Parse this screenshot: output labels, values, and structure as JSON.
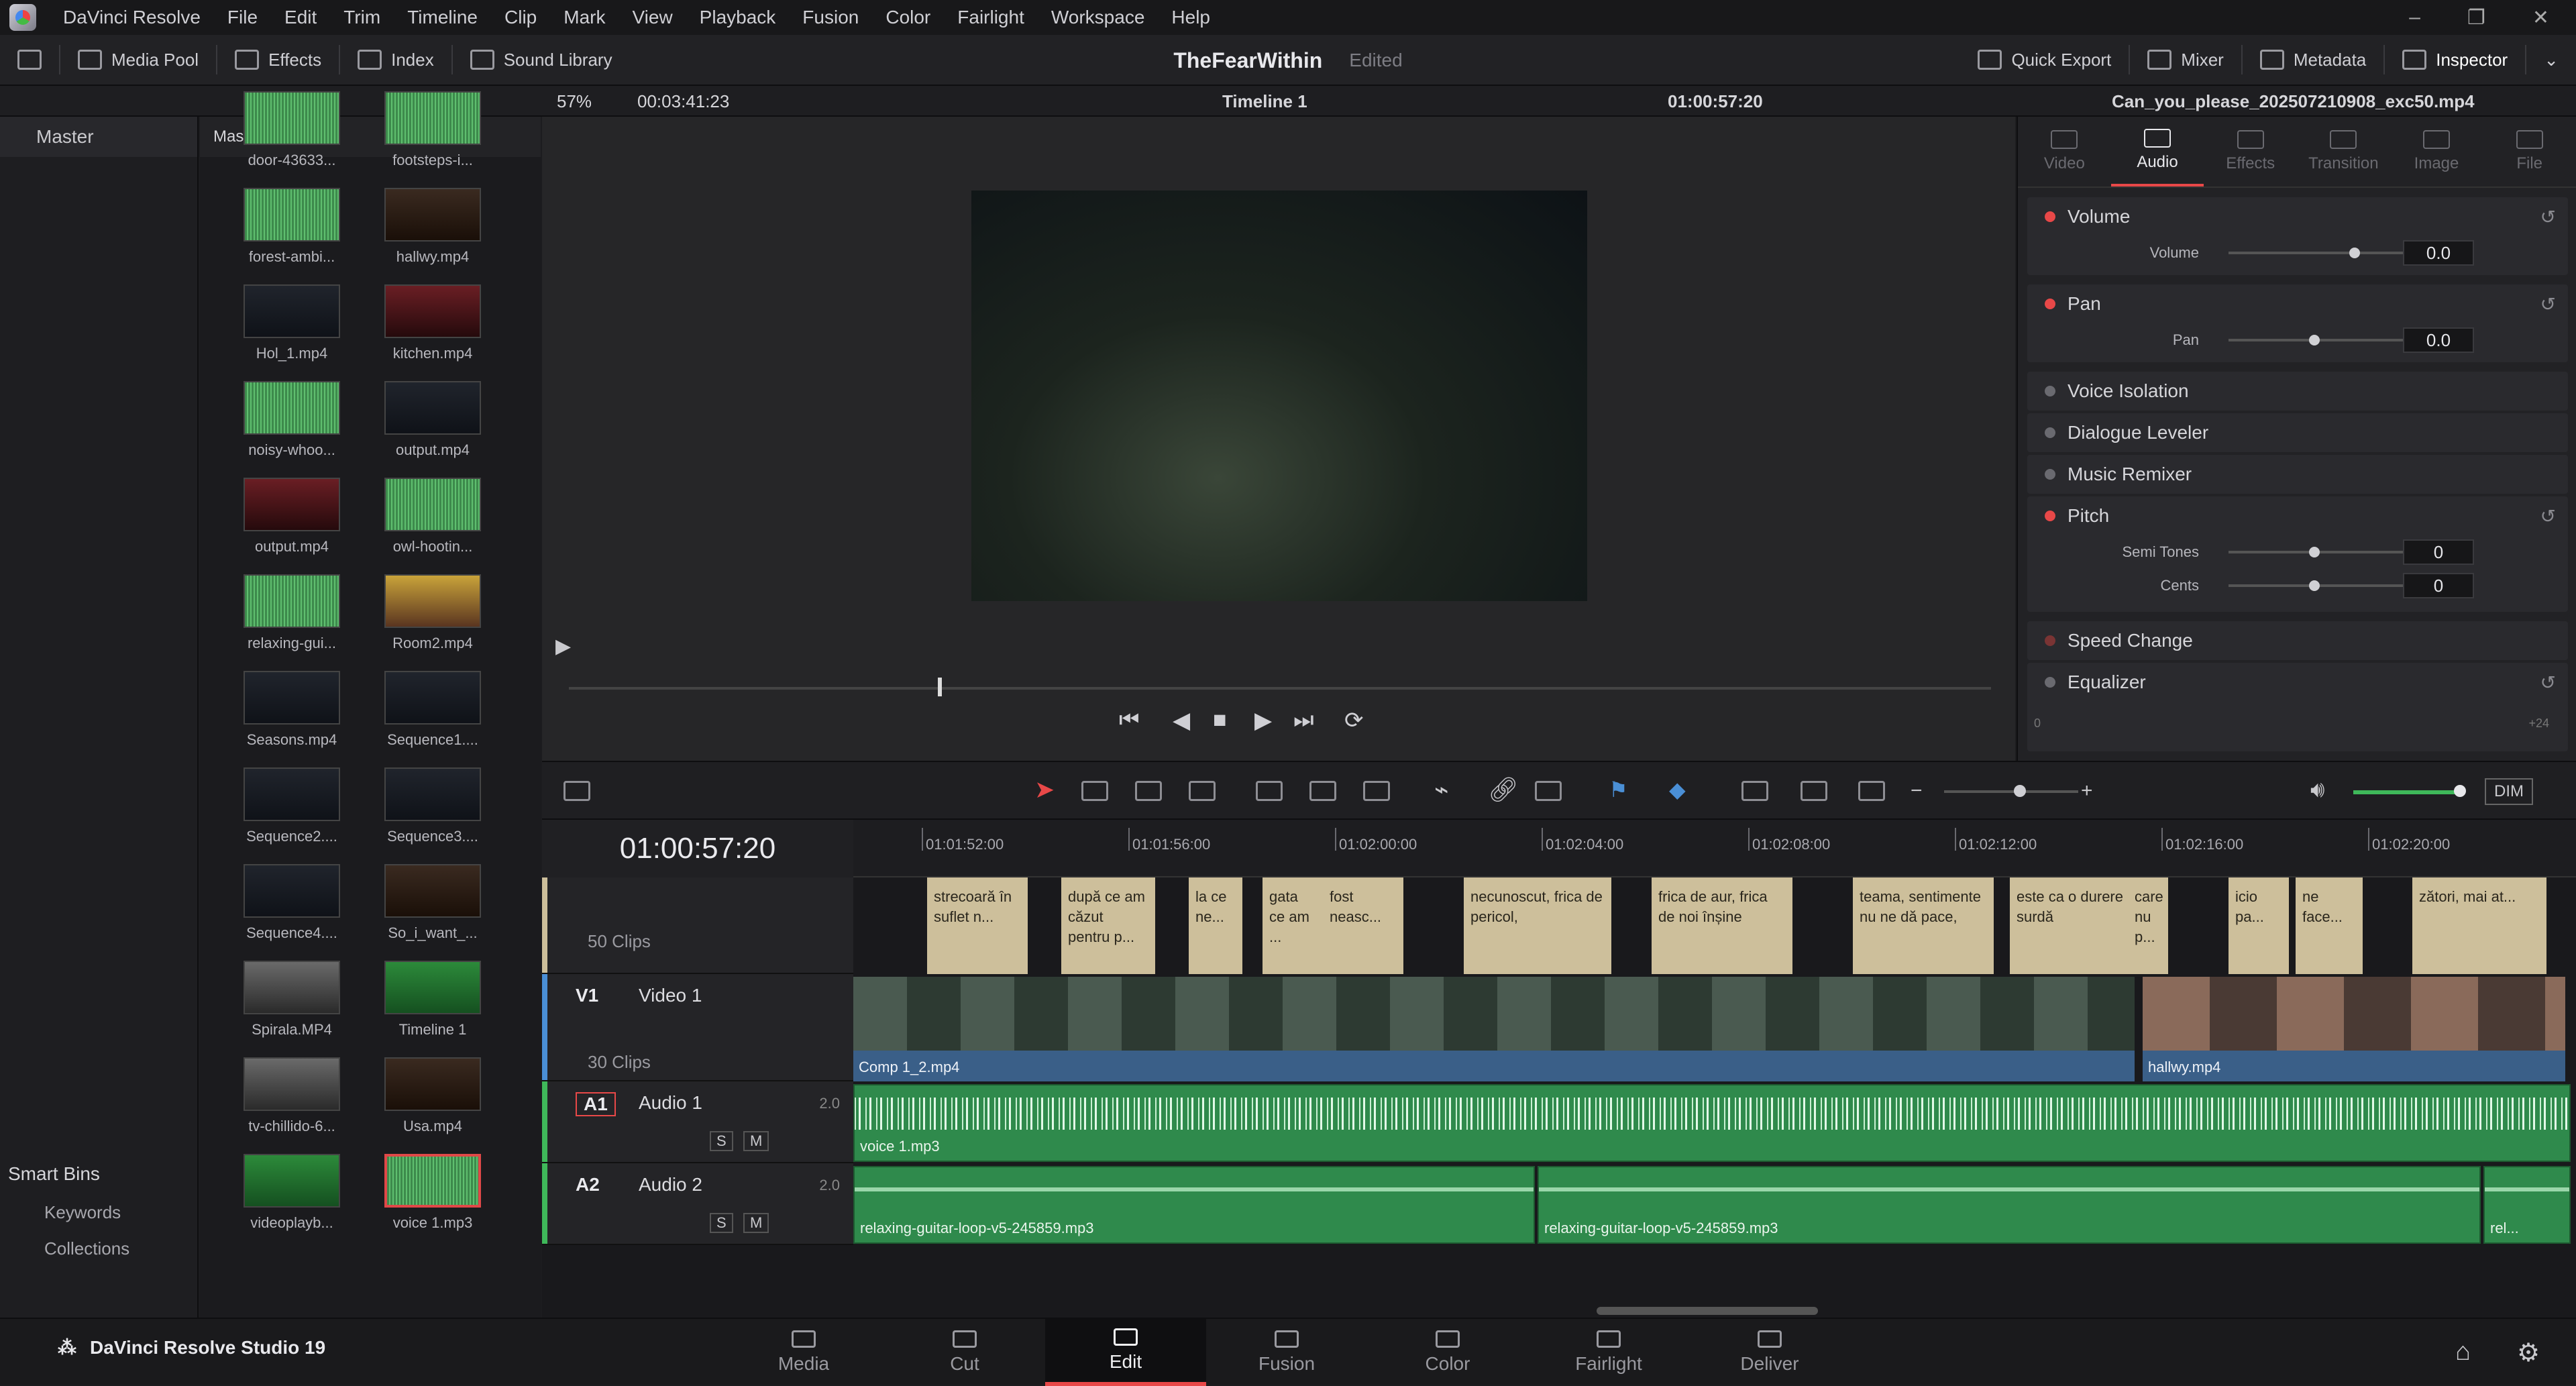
{
  "app": {
    "name": "DaVinci Resolve",
    "product": "DaVinci Resolve Studio 19"
  },
  "menu": [
    "File",
    "Edit",
    "Trim",
    "Timeline",
    "Clip",
    "Mark",
    "View",
    "Playback",
    "Fusion",
    "Color",
    "Fairlight",
    "Workspace",
    "Help"
  ],
  "toolbar": {
    "media_pool": "Media Pool",
    "effects": "Effects",
    "index": "Index",
    "sound_library": "Sound Library",
    "project_title": "TheFearWithin",
    "project_status": "Edited",
    "quick_export": "Quick Export",
    "mixer": "Mixer",
    "metadata": "Metadata",
    "inspector": "Inspector"
  },
  "subbar": {
    "zoom": "57%",
    "duration": "00:03:41:23",
    "timeline_name": "Timeline 1",
    "timecode": "01:00:57:20",
    "inspector_file": "Can_you_please_202507210908_exc50.mp4"
  },
  "bins": {
    "master": "Master",
    "smart_bins": "Smart Bins",
    "items": [
      "Keywords",
      "Collections"
    ]
  },
  "pool": {
    "header": "Master",
    "clips": [
      {
        "label": "door-43633...",
        "style": "audio"
      },
      {
        "label": "footsteps-i...",
        "style": "audio"
      },
      {
        "label": "forest-ambi...",
        "style": "audio"
      },
      {
        "label": "hallwy.mp4",
        "style": "warm"
      },
      {
        "label": "Hol_1.mp4",
        "style": "dark"
      },
      {
        "label": "kitchen.mp4",
        "style": "red"
      },
      {
        "label": "noisy-whoo...",
        "style": "audio"
      },
      {
        "label": "output.mp4",
        "style": "dark"
      },
      {
        "label": "output.mp4",
        "style": "red"
      },
      {
        "label": "owl-hootin...",
        "style": "audio"
      },
      {
        "label": "relaxing-gui...",
        "style": "audio"
      },
      {
        "label": "Room2.mp4",
        "style": "bright"
      },
      {
        "label": "Seasons.mp4",
        "style": "dark"
      },
      {
        "label": "Sequence1....",
        "style": "dark"
      },
      {
        "label": "Sequence2....",
        "style": "dark"
      },
      {
        "label": "Sequence3....",
        "style": "dark"
      },
      {
        "label": "Sequence4....",
        "style": "dark"
      },
      {
        "label": "So_i_want_...",
        "style": "warm"
      },
      {
        "label": "Spirala.MP4",
        "style": "gray"
      },
      {
        "label": "Timeline 1",
        "style": "green"
      },
      {
        "label": "tv-chillido-6...",
        "style": "gray"
      },
      {
        "label": "Usa.mp4",
        "style": "warm"
      },
      {
        "label": "videoplayb...",
        "style": "green"
      },
      {
        "label": "voice 1.mp3",
        "style": "audio"
      }
    ]
  },
  "inspector": {
    "tabs": [
      "Video",
      "Audio",
      "Effects",
      "Transition",
      "Image",
      "File"
    ],
    "active_tab": "Audio",
    "sections": {
      "volume": {
        "title": "Volume",
        "param": "Volume",
        "value": "0.0"
      },
      "pan": {
        "title": "Pan",
        "param": "Pan",
        "value": "0.0"
      },
      "voice_isolation": "Voice Isolation",
      "dialogue_leveler": "Dialogue Leveler",
      "music_remixer": "Music Remixer",
      "pitch": {
        "title": "Pitch",
        "semi_label": "Semi Tones",
        "semi_value": "0",
        "cents_label": "Cents",
        "cents_value": "0"
      },
      "speed_change": "Speed Change",
      "equalizer": "Equalizer",
      "eq_scale_low": "0",
      "eq_scale_high": "+24"
    }
  },
  "timeline": {
    "timecode": "01:00:57:20",
    "ruler": [
      "01:01:52:00",
      "01:01:56:00",
      "01:02:00:00",
      "01:02:04:00",
      "01:02:08:00",
      "01:02:12:00",
      "01:02:16:00",
      "01:02:20:00"
    ],
    "subtitle_track": {
      "clips_count": "50 Clips"
    },
    "subtitles": [
      "strecoară în suflet n...",
      "după ce am căzut pentru p...",
      "la ce ne...",
      "gata ce am ...",
      "fost neasc...",
      "necunoscut, frica de pericol,",
      "frica de aur, frica de noi înșine",
      "teama, sentimente nu ne dă pace,",
      "este ca o durere surdă",
      "care nu p...",
      "icio pa...",
      "ne face...",
      "zători, mai at..."
    ],
    "video_track": {
      "id": "V1",
      "name": "Video 1",
      "clips_count": "30 Clips",
      "clip1": "Comp 1_2.mp4",
      "clip2": "hallwy.mp4"
    },
    "audio1": {
      "id": "A1",
      "name": "Audio 1",
      "channels": "2.0",
      "clip": "voice 1.mp3",
      "solo": "S",
      "mute": "M"
    },
    "audio2": {
      "id": "A2",
      "name": "Audio 2",
      "channels": "2.0",
      "clip1": "relaxing-guitar-loop-v5-245859.mp3",
      "clip2": "relaxing-guitar-loop-v5-245859.mp3",
      "clip3": "rel...",
      "solo": "S",
      "mute": "M"
    },
    "dim": "DIM"
  },
  "pages": [
    "Media",
    "Cut",
    "Edit",
    "Fusion",
    "Color",
    "Fairlight",
    "Deliver"
  ],
  "active_page": "Edit"
}
